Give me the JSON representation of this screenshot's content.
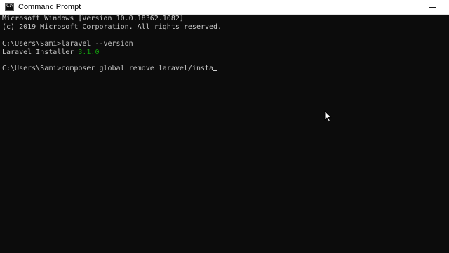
{
  "window": {
    "title": "Command Prompt",
    "icon": "cmd-icon"
  },
  "console": {
    "lines": [
      "Microsoft Windows [Version 10.0.18362.1082]",
      "(c) 2019 Microsoft Corporation. All rights reserved.",
      "",
      "C:\\Users\\Sami>laravel --version",
      "Laravel Installer ",
      "",
      "C:\\Users\\Sami>composer global remove laravel/insta"
    ],
    "installer_version": "3.1.0"
  },
  "colors": {
    "background": "#0c0c0c",
    "text": "#c8c8c8",
    "version": "#13a10e",
    "titlebar": "#ffffff"
  },
  "icons": {
    "pointer": "mouse-pointer-icon",
    "minimize": "minimize-icon"
  }
}
